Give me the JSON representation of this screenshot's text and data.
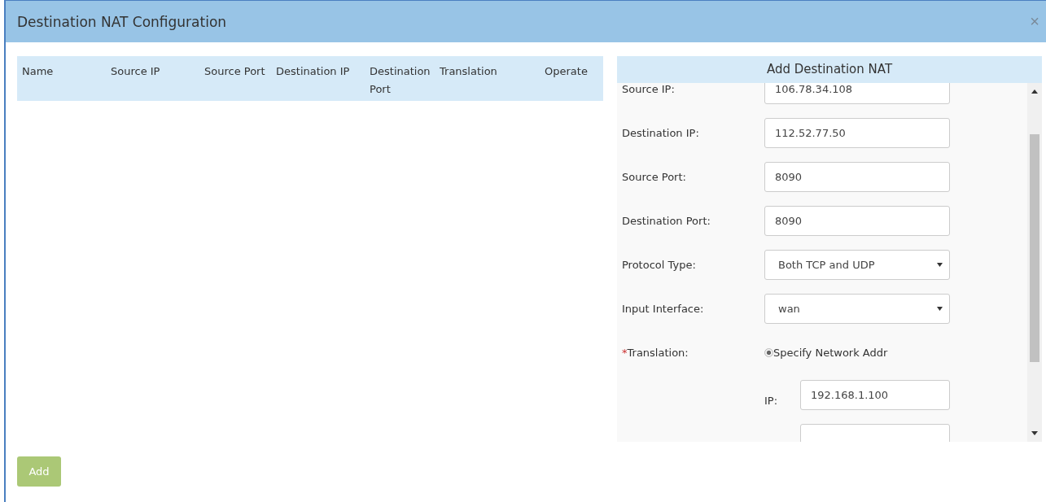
{
  "window": {
    "title": "Destination NAT Configuration",
    "close": "×"
  },
  "table": {
    "columns": [
      {
        "label": "Name"
      },
      {
        "label": "Source IP"
      },
      {
        "label": "Source Port"
      },
      {
        "label": "Destination IP"
      },
      {
        "label": "Destination Port"
      },
      {
        "label": "Translation"
      },
      {
        "label": "Operate"
      }
    ]
  },
  "panel": {
    "title": "Add Destination NAT",
    "fields": [
      {
        "kind": "input",
        "label": "Source IP:",
        "value": "106.78.34.108"
      },
      {
        "kind": "input",
        "label": "Destination IP:",
        "value": "112.52.77.50"
      },
      {
        "kind": "input",
        "label": "Source Port:",
        "value": "8090"
      },
      {
        "kind": "input",
        "label": "Destination Port:",
        "value": "8090"
      },
      {
        "kind": "select",
        "label": "Protocol Type:",
        "value": "Both TCP and UDP"
      },
      {
        "kind": "select",
        "label": "Input Interface:",
        "value": "wan"
      },
      {
        "kind": "radio",
        "label": "Translation:",
        "required_mark": "*",
        "option": "Specify Network Addr",
        "selected": true
      },
      {
        "kind": "subinput",
        "label": "IP:",
        "value": "192.168.1.100"
      }
    ]
  },
  "buttons": [
    {
      "label": "Add"
    }
  ]
}
